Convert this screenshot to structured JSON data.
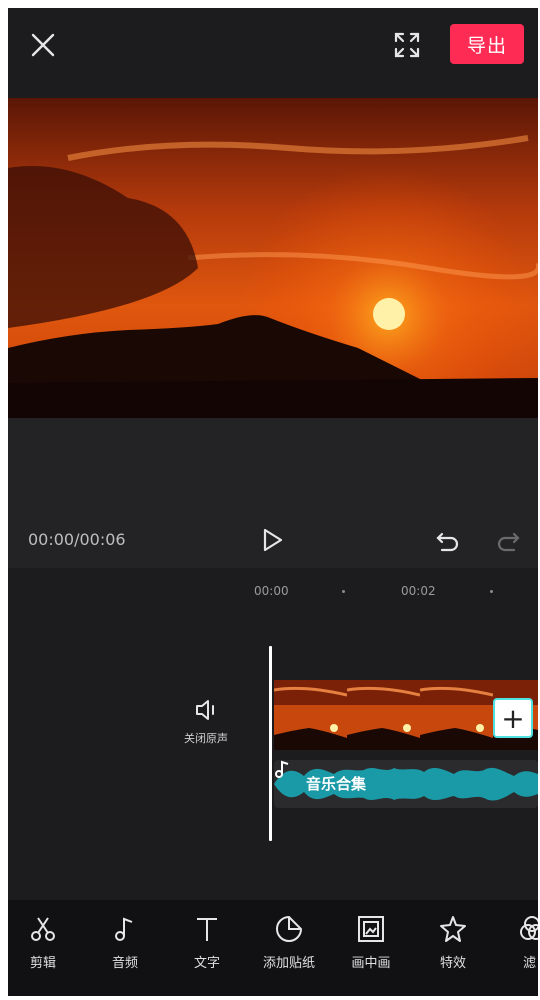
{
  "header": {
    "close_icon": "close-icon",
    "fullscreen_icon": "fullscreen-icon",
    "export_label": "导出"
  },
  "player": {
    "time": "00:00/00:06",
    "play_icon": "play-icon",
    "undo_icon": "undo-icon",
    "redo_icon": "redo-icon"
  },
  "timeline": {
    "ruler": [
      "00:00",
      "00:02"
    ],
    "mute_label": "关闭原声",
    "audio_label": "音乐合集",
    "add_icon": "plus-icon"
  },
  "toolbar": {
    "items": [
      {
        "label": "剪辑",
        "icon": "scissors-icon"
      },
      {
        "label": "音频",
        "icon": "music-note-icon"
      },
      {
        "label": "文字",
        "icon": "text-icon"
      },
      {
        "label": "添加贴纸",
        "icon": "sticker-icon"
      },
      {
        "label": "画中画",
        "icon": "picture-in-picture-icon"
      },
      {
        "label": "特效",
        "icon": "effects-star-icon"
      },
      {
        "label": "滤",
        "icon": "filter-icon"
      }
    ]
  },
  "colors": {
    "export": "#fe2c55",
    "audio_wave": "#1a9aa6",
    "background": "#1c1c1e"
  }
}
